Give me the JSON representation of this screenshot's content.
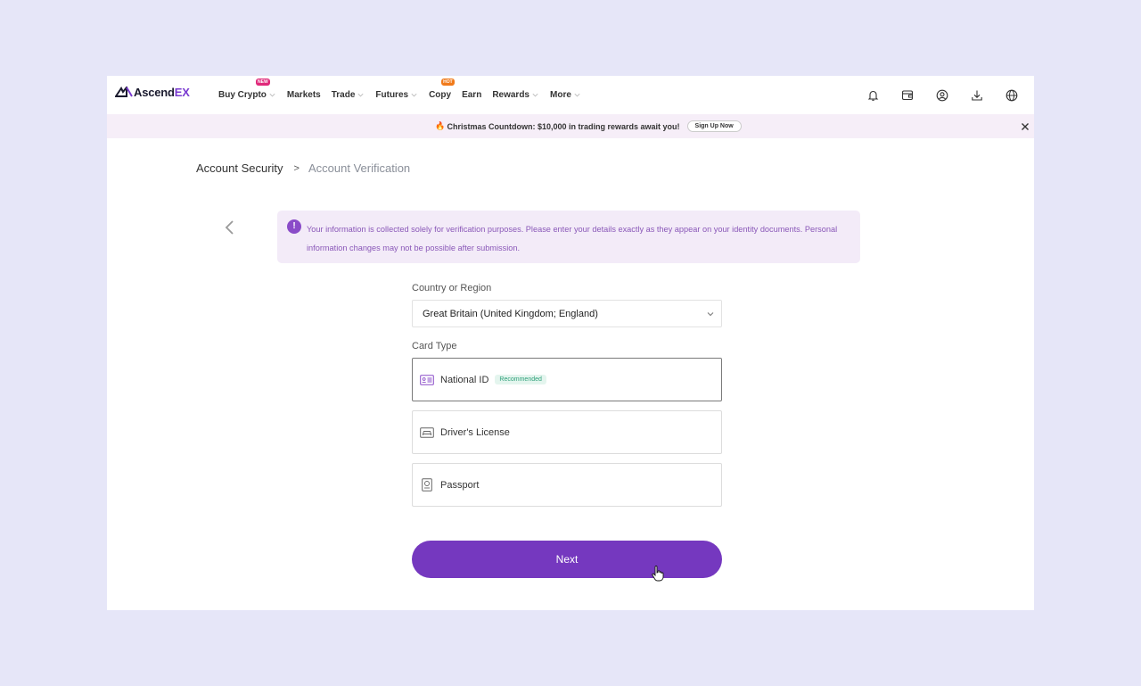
{
  "brand": {
    "name_part1": "Ascend",
    "name_part2": "EX"
  },
  "nav": {
    "items": [
      {
        "label": "Buy Crypto",
        "badge": "NEW",
        "dropdown": true
      },
      {
        "label": "Markets",
        "dropdown": false
      },
      {
        "label": "Trade",
        "dropdown": true
      },
      {
        "label": "Futures",
        "dropdown": true
      },
      {
        "label": "Copy",
        "badge": "HOT",
        "dropdown": false
      },
      {
        "label": "Earn",
        "dropdown": false
      },
      {
        "label": "Rewards",
        "dropdown": true
      },
      {
        "label": "More",
        "dropdown": true
      }
    ],
    "icons": [
      "bell-icon",
      "wallet-icon",
      "user-icon",
      "download-icon",
      "globe-icon"
    ]
  },
  "promo": {
    "text": "Christmas Countdown: $10,000 in trading rewards await you!",
    "button": "Sign Up Now"
  },
  "breadcrumb": {
    "parent": "Account Security",
    "separator": ">",
    "current": "Account Verification"
  },
  "notice": {
    "icon": "!",
    "text": "Your information is collected solely for verification purposes. Please enter your details exactly as they appear on your identity documents. Personal information changes may not be possible after submission."
  },
  "form": {
    "country_label": "Country or Region",
    "country_value": "Great Britain (United Kingdom; England)",
    "card_type_label": "Card Type",
    "cards": [
      {
        "label": "National ID",
        "tag": "Recommended",
        "icon": "id-card-icon",
        "selected": true
      },
      {
        "label": "Driver's License",
        "icon": "car-icon",
        "selected": false
      },
      {
        "label": "Passport",
        "icon": "passport-icon",
        "selected": false
      }
    ],
    "next_label": "Next"
  },
  "colors": {
    "accent": "#7538bf",
    "background": "#e6e6f8",
    "promo_bg": "#f6eef8",
    "notice_bg": "#f3ebf8"
  }
}
